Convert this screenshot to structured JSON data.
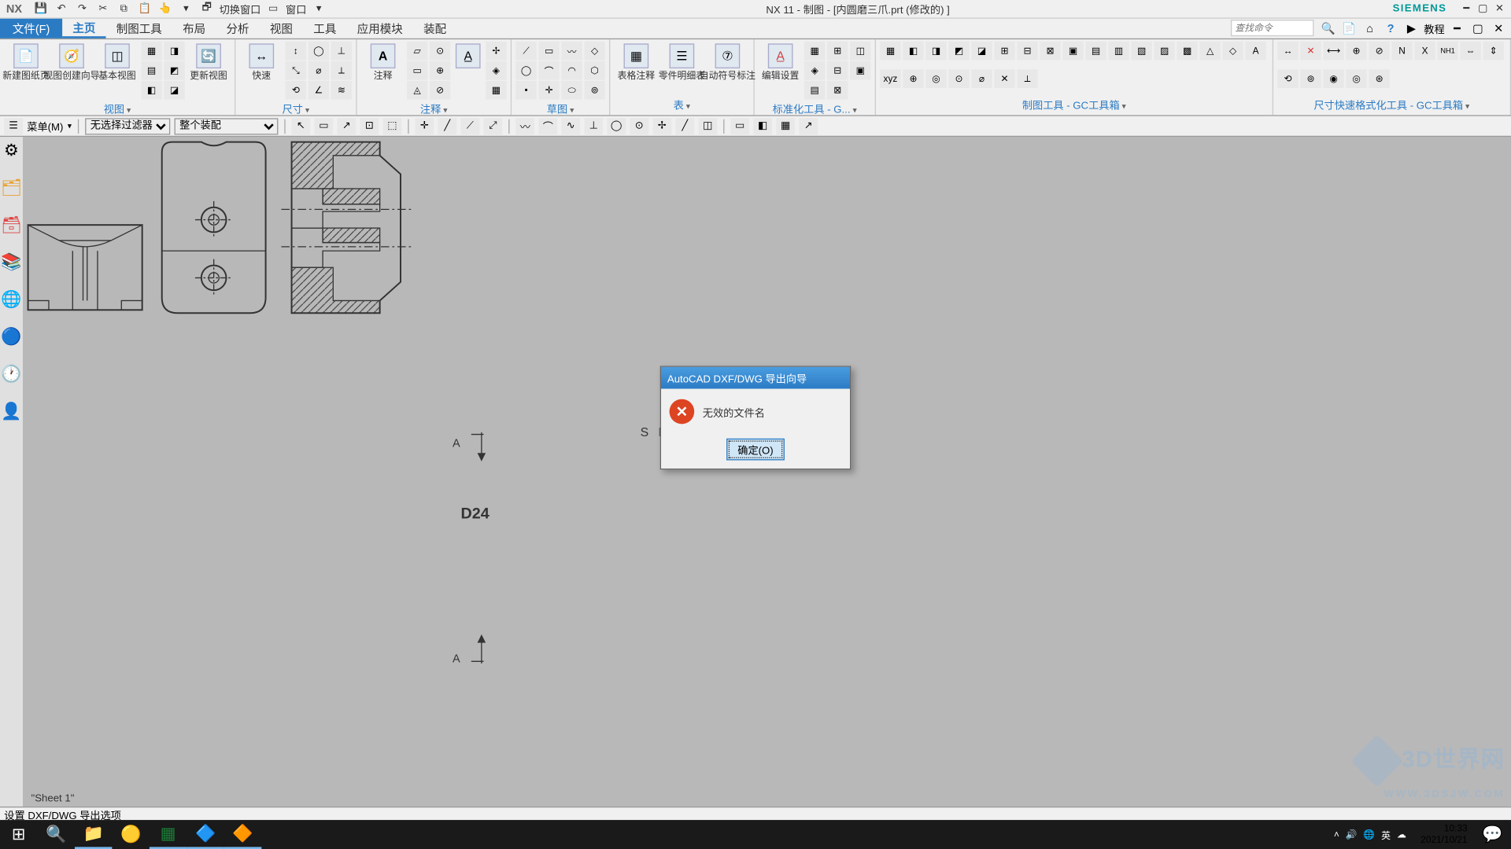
{
  "titlebar": {
    "app": "NX",
    "title": "NX 11 - 制图 - [内圆磨三爪.prt  (修改的)  ]",
    "brand": "SIEMENS",
    "qat": {
      "switch_window": "切换窗口",
      "window": "窗口"
    }
  },
  "menu": {
    "file": "文件(F)",
    "tabs": [
      "主页",
      "制图工具",
      "布局",
      "分析",
      "视图",
      "工具",
      "应用模块",
      "装配"
    ],
    "active": 0,
    "search_placeholder": "查找命令",
    "tutorial": "教程"
  },
  "ribbon": {
    "groups": [
      {
        "label": "视图",
        "big": [
          "新建图纸页",
          "视图创建向导",
          "基本视图",
          "更新视图"
        ]
      },
      {
        "label": "尺寸",
        "big": [
          "快速"
        ]
      },
      {
        "label": "注释",
        "big": [
          "注释"
        ]
      },
      {
        "label": "草图",
        "big": []
      },
      {
        "label": "表",
        "big": [
          "表格注释",
          "零件明细表",
          "自动符号标注"
        ]
      },
      {
        "label": "标准化工具 - G...",
        "big": [
          "编辑设置"
        ]
      },
      {
        "label": "制图工具 - GC工具箱",
        "big": []
      },
      {
        "label": "尺寸快速格式化工具 - GC工具箱",
        "big": []
      }
    ]
  },
  "toolbar2": {
    "menu_btn": "菜单(M)",
    "filter1": "无选择过滤器",
    "filter2": "整个装配"
  },
  "canvas": {
    "sheet_label": "\"Sheet 1\"",
    "section_label": "S E",
    "a_label": "A",
    "part_label": "D24"
  },
  "dialog": {
    "title": "AutoCAD DXF/DWG 导出向导",
    "message": "无效的文件名",
    "ok": "确定(O)"
  },
  "status": "设置 DXF/DWG 导出选项",
  "watermark": {
    "main": "3D世界网",
    "sub": "WWW.3DSJW.COM"
  },
  "taskbar": {
    "ime": "英",
    "time": "10:33",
    "date": "2021/10/21"
  }
}
